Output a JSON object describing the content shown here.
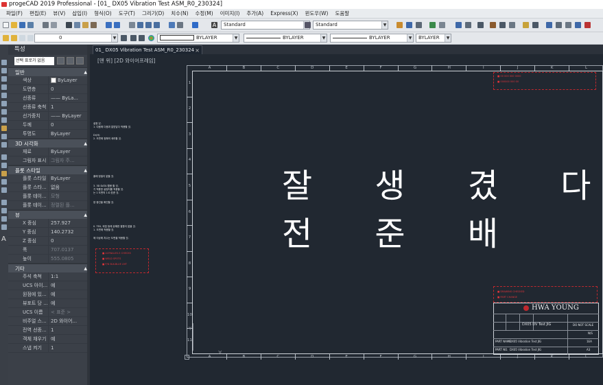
{
  "window": {
    "title": "progeCAD 2019 Professional - [01_ DX05 Vibration Test ASM_R0_230324]"
  },
  "menu": [
    "파일(F)",
    "편집(E)",
    "뷰(V)",
    "삽입(I)",
    "형식(O)",
    "도구(T)",
    "그리기(D)",
    "치수(N)",
    "수정(M)",
    "이미지(I)",
    "추가(A)",
    "Express(X)",
    "윈도우(W)",
    "도움말"
  ],
  "toolbar": {
    "text_style": "Standard",
    "dim_style": "Standard",
    "layer": "0",
    "color": "BYLAYER",
    "linetype": "BYLAYER",
    "lineweight": "BYLAYER",
    "plotstyle": "BYLAYER"
  },
  "properties": {
    "title": "특성",
    "selection": "선택 표로가 없음",
    "sections": [
      {
        "name": "일반",
        "rows": [
          {
            "k": "색상",
            "v": "ByLayer",
            "swatch": true
          },
          {
            "k": "도면층",
            "v": "0"
          },
          {
            "k": "선종류",
            "v": "—— ByLa..."
          },
          {
            "k": "선종류 축척",
            "v": "1"
          },
          {
            "k": "선가중치",
            "v": "—— ByLayer"
          },
          {
            "k": "두께",
            "v": "0"
          },
          {
            "k": "투명도",
            "v": "ByLayer"
          }
        ]
      },
      {
        "name": "3D 시각화",
        "rows": [
          {
            "k": "재료",
            "v": "ByLayer"
          },
          {
            "k": "그림자 표시",
            "v": "그림자 주...",
            "dim": true
          }
        ]
      },
      {
        "name": "플롯 스타일",
        "rows": [
          {
            "k": "플롯 스타일",
            "v": "ByLayer"
          },
          {
            "k": "플롯 스타...",
            "v": "없음"
          },
          {
            "k": "플롯 테이...",
            "v": "모형",
            "dim": true
          },
          {
            "k": "플롯 테이...",
            "v": "정렬된 플...",
            "dim": true
          }
        ]
      },
      {
        "name": "뷰",
        "rows": [
          {
            "k": "X 중심",
            "v": "257.927"
          },
          {
            "k": "Y 중심",
            "v": "140.2732"
          },
          {
            "k": "Z 중심",
            "v": "0"
          },
          {
            "k": "폭",
            "v": "707.0137",
            "dim": true
          },
          {
            "k": "높이",
            "v": "555.0805",
            "dim": true
          }
        ]
      },
      {
        "name": "기타",
        "rows": [
          {
            "k": "주석 축척",
            "v": "1:1"
          },
          {
            "k": "UCS 아이...",
            "v": "예"
          },
          {
            "k": "원점에 있...",
            "v": "예"
          },
          {
            "k": "뷰포트 당 ...",
            "v": "예"
          },
          {
            "k": "UCS 이름",
            "v": "< 표준 >",
            "dim": true
          },
          {
            "k": "비주얼 스...",
            "v": "2D 와이어..."
          },
          {
            "k": "전역 선종...",
            "v": "1"
          },
          {
            "k": "객체 채우기",
            "v": "예"
          },
          {
            "k": "스냅 켜기",
            "v": "1"
          }
        ]
      }
    ]
  },
  "tab": {
    "label": "01_ DX05 Vibration Test ASM_R0_230324",
    "close": "×"
  },
  "viewport": {
    "label": "[맨 위] [2D 와이어프레임]"
  },
  "drawing": {
    "line1": "잘 생 겼 다",
    "line2": "전 준 배",
    "col_labels": [
      "A",
      "B",
      "C",
      "D",
      "E",
      "F",
      "G",
      "H",
      "I",
      "J",
      "K",
      "L"
    ],
    "row_labels": [
      "1",
      "2",
      "3",
      "4",
      "5",
      "6",
      "7",
      "8",
      "9",
      "10",
      "11"
    ],
    "titleblock": {
      "company": "HWA YOUNG",
      "title": "DX05 DV Test JIG",
      "part_name": "DX05 Vibration Test JIG",
      "part_no": "DX05 Vibration Test JIG",
      "note": "DO NOT SCALE",
      "scale": "N/S",
      "size": "A3",
      "qty": "1EA"
    }
  },
  "colors": {
    "canvas": "#212831",
    "panel": "#3b4048",
    "accent_red": "#c0282e"
  }
}
